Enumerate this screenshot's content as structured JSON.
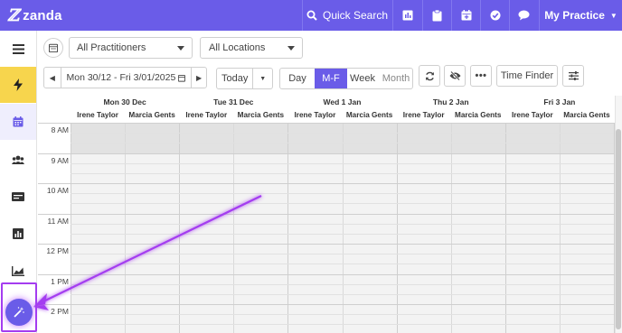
{
  "topbar": {
    "brand": "zanda",
    "quick_search": "Quick Search",
    "practice": "My Practice",
    "bg_color": "#6a5ce8",
    "icons": [
      "search-icon",
      "report-icon",
      "clipboard-icon",
      "calendar-add-icon",
      "check-circle-icon",
      "chat-icon",
      "chevron-down-icon"
    ]
  },
  "sidebar": {
    "items": [
      "menu-icon",
      "bolt-icon",
      "calendar-icon",
      "clients-icon",
      "billing-icon",
      "reports-icon",
      "analytics-icon"
    ],
    "magic_button": "magic-wand-icon"
  },
  "toolbar": {
    "practitioners": "All Practitioners",
    "locations": "All Locations",
    "date_range": "Mon 30/12 - Fri 3/01/2025",
    "today": "Today",
    "views": [
      "Day",
      "M-F",
      "Week",
      "Month"
    ],
    "active_view": "M-F",
    "time_finder": "Time Finder"
  },
  "calendar": {
    "days": [
      "Mon 30 Dec",
      "Tue 31 Dec",
      "Wed 1 Jan",
      "Thu 2 Jan",
      "Fri 3 Jan"
    ],
    "practitioners": [
      "Irene Taylor",
      "Marcia Gents"
    ],
    "times": [
      "8 AM",
      "9 AM",
      "10 AM",
      "11 AM",
      "12 PM",
      "1 PM",
      "2 PM"
    ]
  },
  "annotation": {
    "arrow_color": "#a43cf0"
  }
}
